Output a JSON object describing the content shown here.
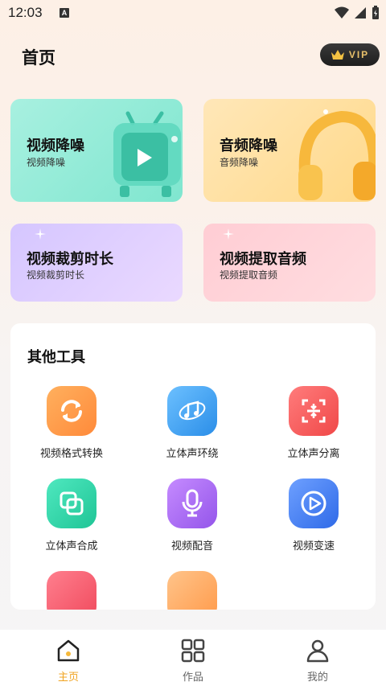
{
  "status_bar": {
    "time": "12:03",
    "notification_glyph": "A"
  },
  "header": {
    "title": "首页",
    "vip_label": "VIP"
  },
  "feature_cards": [
    {
      "title": "视频降噪",
      "subtitle": "视频降噪",
      "icon": "tv-play-icon",
      "color": "#8ce9d4"
    },
    {
      "title": "音频降噪",
      "subtitle": "音频降噪",
      "icon": "headphones-icon",
      "color": "#ffdf9a"
    },
    {
      "title": "视频裁剪时长",
      "subtitle": "视频裁剪时长",
      "color": "#dccdff"
    },
    {
      "title": "视频提取音频",
      "subtitle": "视频提取音频",
      "color": "#ffd3d8"
    }
  ],
  "tools": {
    "title": "其他工具",
    "items": [
      {
        "label": "视频格式转换",
        "icon": "convert-icon",
        "color": "#ff9a4a"
      },
      {
        "label": "立体声环绕",
        "icon": "music-note-icon",
        "color": "#3aa0f0"
      },
      {
        "label": "立体声分离",
        "icon": "split-icon",
        "color": "#ff5a5a"
      },
      {
        "label": "立体声合成",
        "icon": "merge-icon",
        "color": "#2fd6a8"
      },
      {
        "label": "视频配音",
        "icon": "microphone-icon",
        "color": "#a66af0"
      },
      {
        "label": "视频变速",
        "icon": "play-speed-icon",
        "color": "#3d7df0"
      }
    ]
  },
  "bottom_nav": [
    {
      "label": "主页",
      "icon": "home-icon",
      "active": true
    },
    {
      "label": "作品",
      "icon": "grid-icon",
      "active": false
    },
    {
      "label": "我的",
      "icon": "user-icon",
      "active": false
    }
  ]
}
